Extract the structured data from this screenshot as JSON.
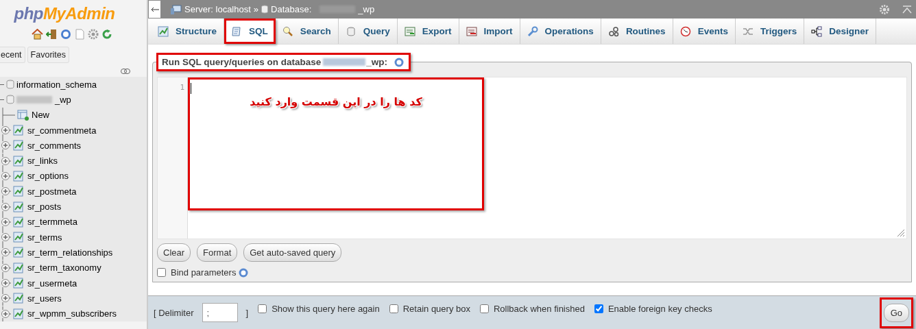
{
  "sidebar": {
    "logo": {
      "prefix": "php",
      "name": "MyAdmin"
    },
    "tabs": [
      {
        "label": "ecent"
      },
      {
        "label": "Favorites"
      }
    ],
    "tree": [
      {
        "label": "information_schema",
        "kind": "database"
      },
      {
        "label": "_wp",
        "kind": "database",
        "children": [
          {
            "label": "New",
            "kind": "new"
          },
          {
            "label": "sr_commentmeta",
            "kind": "table"
          },
          {
            "label": "sr_comments",
            "kind": "table"
          },
          {
            "label": "sr_links",
            "kind": "table"
          },
          {
            "label": "sr_options",
            "kind": "table"
          },
          {
            "label": "sr_postmeta",
            "kind": "table"
          },
          {
            "label": "sr_posts",
            "kind": "table"
          },
          {
            "label": "sr_termmeta",
            "kind": "table"
          },
          {
            "label": "sr_terms",
            "kind": "table"
          },
          {
            "label": "sr_term_relationships",
            "kind": "table"
          },
          {
            "label": "sr_term_taxonomy",
            "kind": "table"
          },
          {
            "label": "sr_usermeta",
            "kind": "table"
          },
          {
            "label": "sr_users",
            "kind": "table"
          },
          {
            "label": "sr_wpmm_subscribers",
            "kind": "table"
          }
        ]
      }
    ]
  },
  "breadcrumb": {
    "server": "Server: localhost",
    "separator": "»",
    "database_label": "Database:",
    "database": "_wp"
  },
  "tabs": [
    {
      "label": "Structure",
      "selected": false,
      "highlighted": false
    },
    {
      "label": "SQL",
      "selected": true,
      "highlighted": true
    },
    {
      "label": "Search",
      "selected": false,
      "highlighted": false
    },
    {
      "label": "Query",
      "selected": false,
      "highlighted": false
    },
    {
      "label": "Export",
      "selected": false,
      "highlighted": false
    },
    {
      "label": "Import",
      "selected": false,
      "highlighted": false
    },
    {
      "label": "Operations",
      "selected": false,
      "highlighted": false
    },
    {
      "label": "Routines",
      "selected": false,
      "highlighted": false
    },
    {
      "label": "Events",
      "selected": false,
      "highlighted": false
    },
    {
      "label": "Triggers",
      "selected": false,
      "highlighted": false
    },
    {
      "label": "Designer",
      "selected": false,
      "highlighted": false
    }
  ],
  "panel": {
    "legend": "Run SQL query/queries on database",
    "database": "_wp:",
    "highlighted": true,
    "editor": {
      "line_numbers": [
        "1"
      ],
      "note": "کد ها را در این قسمت وارد کنید"
    },
    "buttons": [
      "Clear",
      "Format",
      "Get auto-saved query"
    ],
    "bind_parameters": {
      "label": "Bind parameters",
      "checked": false
    }
  },
  "footer": {
    "delimiter_open": "[ Delimiter",
    "delimiter_value": ";",
    "delimiter_close": "]",
    "options": [
      {
        "label": "Show this query here again",
        "checked": false
      },
      {
        "label": "Retain query box",
        "checked": false
      },
      {
        "label": "Rollback when finished",
        "checked": false
      },
      {
        "label": "Enable foreign key checks",
        "checked": true
      }
    ],
    "go": {
      "label": "Go",
      "highlighted": true
    }
  }
}
